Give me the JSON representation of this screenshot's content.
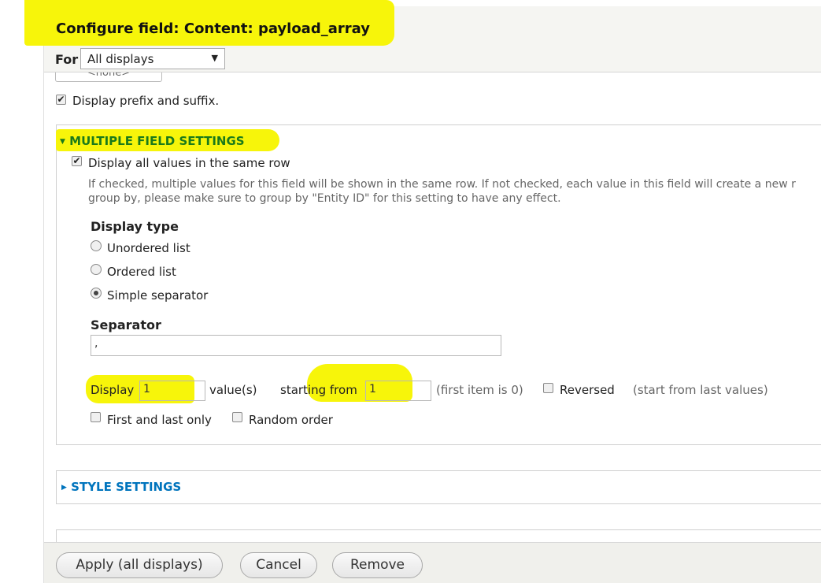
{
  "dialog": {
    "title": "Configure field: Content: payload_array",
    "for_label": "For",
    "for_select": "All displays"
  },
  "partial_select": "<none>",
  "prefix_suffix": {
    "label": "Display prefix and suffix.",
    "checked": true
  },
  "multiple": {
    "section_title": "MULTIPLE FIELD SETTINGS",
    "same_row_label": "Display all values in the same row",
    "description_line1": "If checked, multiple values for this field will be shown in the same row. If not checked, each value in this field will create a new r",
    "description_line2": "group by, please make sure to group by \"Entity ID\" for this setting to have any effect.",
    "display_type_label": "Display type",
    "display_types": [
      "Unordered list",
      "Ordered list",
      "Simple separator"
    ],
    "selected_display_type": "Simple separator",
    "separator_label": "Separator",
    "separator_value": ",",
    "display_label": "Display",
    "display_value": "1",
    "values_suffix": "value(s)",
    "starting_from_label": "starting from",
    "starting_from_value": "1",
    "first_item_note": "(first item is 0)",
    "reversed_label": "Reversed",
    "reversed_note": "(start from last values)",
    "first_last_label": "First and last only",
    "random_label": "Random order"
  },
  "style": {
    "section_title": "STYLE SETTINGS"
  },
  "buttons": {
    "apply": "Apply (all displays)",
    "cancel": "Cancel",
    "remove": "Remove"
  },
  "colors": {
    "highlight": "#f7f50a",
    "link_blue": "#0074bd",
    "section_green": "#1a7a1a"
  }
}
